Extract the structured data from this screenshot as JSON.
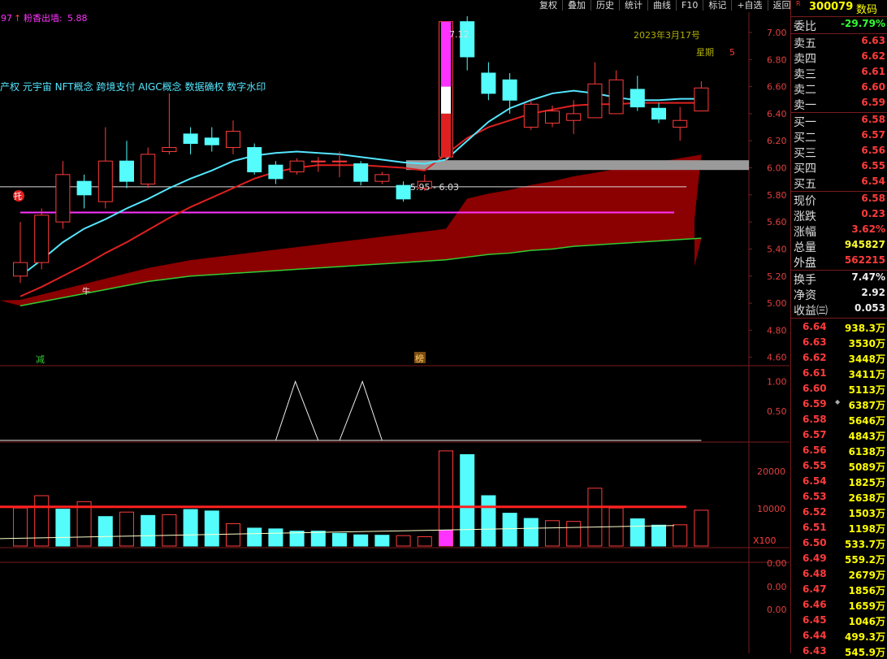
{
  "toolbar": [
    "复权",
    "叠加",
    "历史",
    "统计",
    "曲线",
    "F10",
    "标记",
    "+自选",
    "返回"
  ],
  "stock": {
    "r_mark": "R",
    "code": "300079",
    "name": "数码"
  },
  "header": {
    "prev": "97",
    "arrow": "↑",
    "indicator_label": "粉香出墙:",
    "indicator_value": "5.88"
  },
  "concepts": "产权 元宇宙 NFT概念 跨境支付 AIGC概念 数据确权 数字水印",
  "date_label": "2023年3月17号",
  "weekday_label": "星期",
  "weekday_value": "5",
  "high_label": "7.12",
  "low_range_label": "5.95 - 6.03",
  "marks": {
    "tuo": "托",
    "jian": "减",
    "bang": "榜",
    "niu": "牛",
    "x100": "X100"
  },
  "price_axis": [
    "7.00",
    "6.80",
    "6.60",
    "6.40",
    "6.20",
    "6.00",
    "5.80",
    "5.60",
    "5.40",
    "5.20",
    "5.00",
    "4.80",
    "4.60"
  ],
  "ind_axis": [
    "1.00",
    "0.50"
  ],
  "vol_axis": [
    "20000",
    "10000"
  ],
  "bottom_axis": [
    "0.00",
    "0.00",
    "0.00"
  ],
  "quote_top": [
    {
      "label": "委比",
      "value": "-29.79%",
      "color": "grn"
    }
  ],
  "asks": [
    {
      "label": "卖五",
      "value": "6.63",
      "color": "red"
    },
    {
      "label": "卖四",
      "value": "6.62",
      "color": "red"
    },
    {
      "label": "卖三",
      "value": "6.61",
      "color": "red"
    },
    {
      "label": "卖二",
      "value": "6.60",
      "color": "red"
    },
    {
      "label": "卖一",
      "value": "6.59",
      "color": "red"
    }
  ],
  "bids": [
    {
      "label": "买一",
      "value": "6.58",
      "color": "red"
    },
    {
      "label": "买二",
      "value": "6.57",
      "color": "red"
    },
    {
      "label": "买三",
      "value": "6.56",
      "color": "red"
    },
    {
      "label": "买四",
      "value": "6.55",
      "color": "red"
    },
    {
      "label": "买五",
      "value": "6.54",
      "color": "red"
    }
  ],
  "stats1": [
    {
      "label": "现价",
      "value": "6.58",
      "color": "red"
    },
    {
      "label": "涨跌",
      "value": "0.23",
      "color": "red"
    },
    {
      "label": "涨幅",
      "value": "3.62%",
      "color": "red"
    },
    {
      "label": "总量",
      "value": "945827",
      "color": "yel"
    },
    {
      "label": "外盘",
      "value": "562215",
      "color": "red"
    }
  ],
  "stats2": [
    {
      "label": "换手",
      "value": "7.47%",
      "color": "wht"
    },
    {
      "label": "净资",
      "value": "2.92",
      "color": "wht"
    },
    {
      "label": "收益㈢",
      "value": "0.053",
      "color": "wht"
    }
  ],
  "orderbook": [
    {
      "price": "6.64",
      "qty": "938.3万",
      "pcolor": "red",
      "qcolor": "yel",
      "dot": ""
    },
    {
      "price": "6.63",
      "qty": "3530万",
      "pcolor": "red",
      "qcolor": "yel",
      "dot": ""
    },
    {
      "price": "6.62",
      "qty": "3448万",
      "pcolor": "red",
      "qcolor": "yel",
      "dot": ""
    },
    {
      "price": "6.61",
      "qty": "3411万",
      "pcolor": "red",
      "qcolor": "yel",
      "dot": ""
    },
    {
      "price": "6.60",
      "qty": "5113万",
      "pcolor": "red",
      "qcolor": "yel",
      "dot": ""
    },
    {
      "price": "6.59",
      "qty": "6387万",
      "pcolor": "red",
      "qcolor": "mag",
      "dot": "◆"
    },
    {
      "price": "6.58",
      "qty": "5646万",
      "pcolor": "red",
      "qcolor": "mag",
      "dot": ""
    },
    {
      "price": "6.57",
      "qty": "4843万",
      "pcolor": "red",
      "qcolor": "yel",
      "dot": ""
    },
    {
      "price": "6.56",
      "qty": "6138万",
      "pcolor": "red",
      "qcolor": "mag",
      "dot": ""
    },
    {
      "price": "6.55",
      "qty": "5089万",
      "pcolor": "red",
      "qcolor": "yel",
      "dot": ""
    },
    {
      "price": "6.54",
      "qty": "1825万",
      "pcolor": "red",
      "qcolor": "yel",
      "dot": ""
    },
    {
      "price": "6.53",
      "qty": "2638万",
      "pcolor": "red",
      "qcolor": "yel",
      "dot": ""
    },
    {
      "price": "6.52",
      "qty": "1503万",
      "pcolor": "red",
      "qcolor": "yel",
      "dot": ""
    },
    {
      "price": "6.51",
      "qty": "1198万",
      "pcolor": "red",
      "qcolor": "yel",
      "dot": ""
    },
    {
      "price": "6.50",
      "qty": "533.7万",
      "pcolor": "red",
      "qcolor": "yel",
      "dot": ""
    },
    {
      "price": "6.49",
      "qty": "559.2万",
      "pcolor": "red",
      "qcolor": "yel",
      "dot": ""
    },
    {
      "price": "6.48",
      "qty": "2679万",
      "pcolor": "red",
      "qcolor": "yel",
      "dot": ""
    },
    {
      "price": "6.47",
      "qty": "1856万",
      "pcolor": "red",
      "qcolor": "yel",
      "dot": ""
    },
    {
      "price": "6.46",
      "qty": "1659万",
      "pcolor": "red",
      "qcolor": "yel",
      "dot": ""
    },
    {
      "price": "6.45",
      "qty": "1046万",
      "pcolor": "red",
      "qcolor": "yel",
      "dot": ""
    },
    {
      "price": "6.44",
      "qty": "499.3万",
      "pcolor": "red",
      "qcolor": "yel",
      "dot": ""
    },
    {
      "price": "6.43",
      "qty": "545.9万",
      "pcolor": "red",
      "qcolor": "yel",
      "dot": ""
    }
  ],
  "colors": {
    "up": "#ff3b3b",
    "down": "#54fcfc",
    "ma_fast": "#54e6ff",
    "ma_mid": "#e02020",
    "ma_slow": "#33cc33",
    "cloud": "#8b0000",
    "magenta": "#ff33ff",
    "grey_band": "#9a9a9a"
  },
  "chart_data": {
    "type": "candlestick",
    "price_range": [
      4.55,
      7.15
    ],
    "candles": [
      {
        "o": 5.2,
        "c": 5.3,
        "h": 5.6,
        "l": 5.15
      },
      {
        "o": 5.3,
        "c": 5.65,
        "h": 5.7,
        "l": 5.25
      },
      {
        "o": 5.6,
        "c": 5.95,
        "h": 6.05,
        "l": 5.55
      },
      {
        "o": 5.9,
        "c": 5.8,
        "h": 5.95,
        "l": 5.7
      },
      {
        "o": 5.75,
        "c": 6.05,
        "h": 6.3,
        "l": 5.7
      },
      {
        "o": 6.05,
        "c": 5.9,
        "h": 6.2,
        "l": 5.85
      },
      {
        "o": 5.88,
        "c": 6.1,
        "h": 6.15,
        "l": 5.85
      },
      {
        "o": 6.12,
        "c": 6.15,
        "h": 6.55,
        "l": 6.1
      },
      {
        "o": 6.25,
        "c": 6.18,
        "h": 6.3,
        "l": 6.1
      },
      {
        "o": 6.22,
        "c": 6.17,
        "h": 6.3,
        "l": 6.12
      },
      {
        "o": 6.15,
        "c": 6.27,
        "h": 6.35,
        "l": 6.1
      },
      {
        "o": 6.15,
        "c": 5.97,
        "h": 6.18,
        "l": 5.95
      },
      {
        "o": 6.02,
        "c": 5.92,
        "h": 6.05,
        "l": 5.88
      },
      {
        "o": 5.97,
        "c": 6.05,
        "h": 6.07,
        "l": 5.95
      },
      {
        "o": 6.05,
        "c": 6.05,
        "h": 6.08,
        "l": 5.97
      },
      {
        "o": 6.05,
        "c": 6.05,
        "h": 6.12,
        "l": 5.93
      },
      {
        "o": 6.03,
        "c": 5.9,
        "h": 6.05,
        "l": 5.87
      },
      {
        "o": 5.9,
        "c": 5.95,
        "h": 5.97,
        "l": 5.88
      },
      {
        "o": 5.87,
        "c": 5.77,
        "h": 5.9,
        "l": 5.75
      },
      {
        "o": 5.85,
        "c": 5.9,
        "h": 5.95,
        "l": 5.83
      },
      {
        "o": 6.08,
        "c": 7.08,
        "h": 7.08,
        "l": 6.05
      },
      {
        "o": 7.08,
        "c": 6.82,
        "h": 7.12,
        "l": 6.72
      },
      {
        "o": 6.7,
        "c": 6.55,
        "h": 6.78,
        "l": 6.5
      },
      {
        "o": 6.65,
        "c": 6.5,
        "h": 6.7,
        "l": 6.4
      },
      {
        "o": 6.3,
        "c": 6.47,
        "h": 6.5,
        "l": 6.28
      },
      {
        "o": 6.33,
        "c": 6.42,
        "h": 6.46,
        "l": 6.3
      },
      {
        "o": 6.35,
        "c": 6.4,
        "h": 6.5,
        "l": 6.25
      },
      {
        "o": 6.37,
        "c": 6.62,
        "h": 6.78,
        "l": 6.37
      },
      {
        "o": 6.4,
        "c": 6.65,
        "h": 6.72,
        "l": 6.4
      },
      {
        "o": 6.58,
        "c": 6.45,
        "h": 6.68,
        "l": 6.42
      },
      {
        "o": 6.44,
        "c": 6.36,
        "h": 6.48,
        "l": 6.33
      },
      {
        "o": 6.3,
        "c": 6.35,
        "h": 6.45,
        "l": 6.2
      },
      {
        "o": 6.42,
        "c": 6.59,
        "h": 6.64,
        "l": 6.42
      }
    ],
    "ma_fast": [
      5.2,
      5.32,
      5.45,
      5.55,
      5.62,
      5.7,
      5.77,
      5.85,
      5.92,
      5.98,
      6.05,
      6.09,
      6.11,
      6.12,
      6.11,
      6.1,
      6.08,
      6.06,
      6.04,
      6.03,
      6.06,
      6.2,
      6.34,
      6.44,
      6.5,
      6.55,
      6.57,
      6.55,
      6.52,
      6.5,
      6.5,
      6.51,
      6.51
    ],
    "ma_mid": [
      5.05,
      5.12,
      5.2,
      5.28,
      5.37,
      5.45,
      5.54,
      5.63,
      5.71,
      5.78,
      5.85,
      5.92,
      5.97,
      6.0,
      6.02,
      6.02,
      6.02,
      6.01,
      6.0,
      5.98,
      6.1,
      6.22,
      6.3,
      6.35,
      6.4,
      6.43,
      6.46,
      6.47,
      6.47,
      6.48,
      6.48,
      6.48,
      6.48
    ],
    "ma_slow": [
      4.98,
      5.01,
      5.04,
      5.07,
      5.1,
      5.13,
      5.16,
      5.18,
      5.2,
      5.21,
      5.22,
      5.23,
      5.24,
      5.25,
      5.26,
      5.27,
      5.28,
      5.29,
      5.3,
      5.31,
      5.32,
      5.34,
      5.36,
      5.37,
      5.39,
      5.4,
      5.42,
      5.43,
      5.44,
      5.45,
      5.46,
      5.47,
      5.48
    ],
    "indicator": [
      0,
      0,
      0,
      0,
      0,
      0,
      0,
      0,
      0,
      0,
      0,
      0,
      0,
      1,
      0,
      0,
      1,
      0,
      0,
      0,
      0,
      0,
      0,
      0,
      0,
      0,
      0,
      0,
      0,
      0,
      0,
      0,
      0
    ],
    "ind_range": [
      0,
      1.2
    ],
    "volumes": [
      10200,
      13500,
      9900,
      11900,
      7900,
      9100,
      8200,
      8400,
      9800,
      9400,
      6000,
      4800,
      4600,
      4000,
      4000,
      3400,
      3000,
      2900,
      2800,
      2500,
      25500,
      24500,
      13500,
      8800,
      7400,
      6800,
      6600,
      15500,
      10200,
      7300,
      5600,
      5700,
      9600
    ],
    "volume_up": [
      true,
      true,
      false,
      true,
      false,
      true,
      false,
      true,
      false,
      false,
      true,
      false,
      false,
      false,
      false,
      false,
      false,
      false,
      true,
      true,
      true,
      false,
      false,
      false,
      false,
      true,
      true,
      true,
      true,
      false,
      false,
      true,
      true
    ],
    "vol_range": [
      0,
      27000
    ],
    "vol_ref_line": 10500
  }
}
